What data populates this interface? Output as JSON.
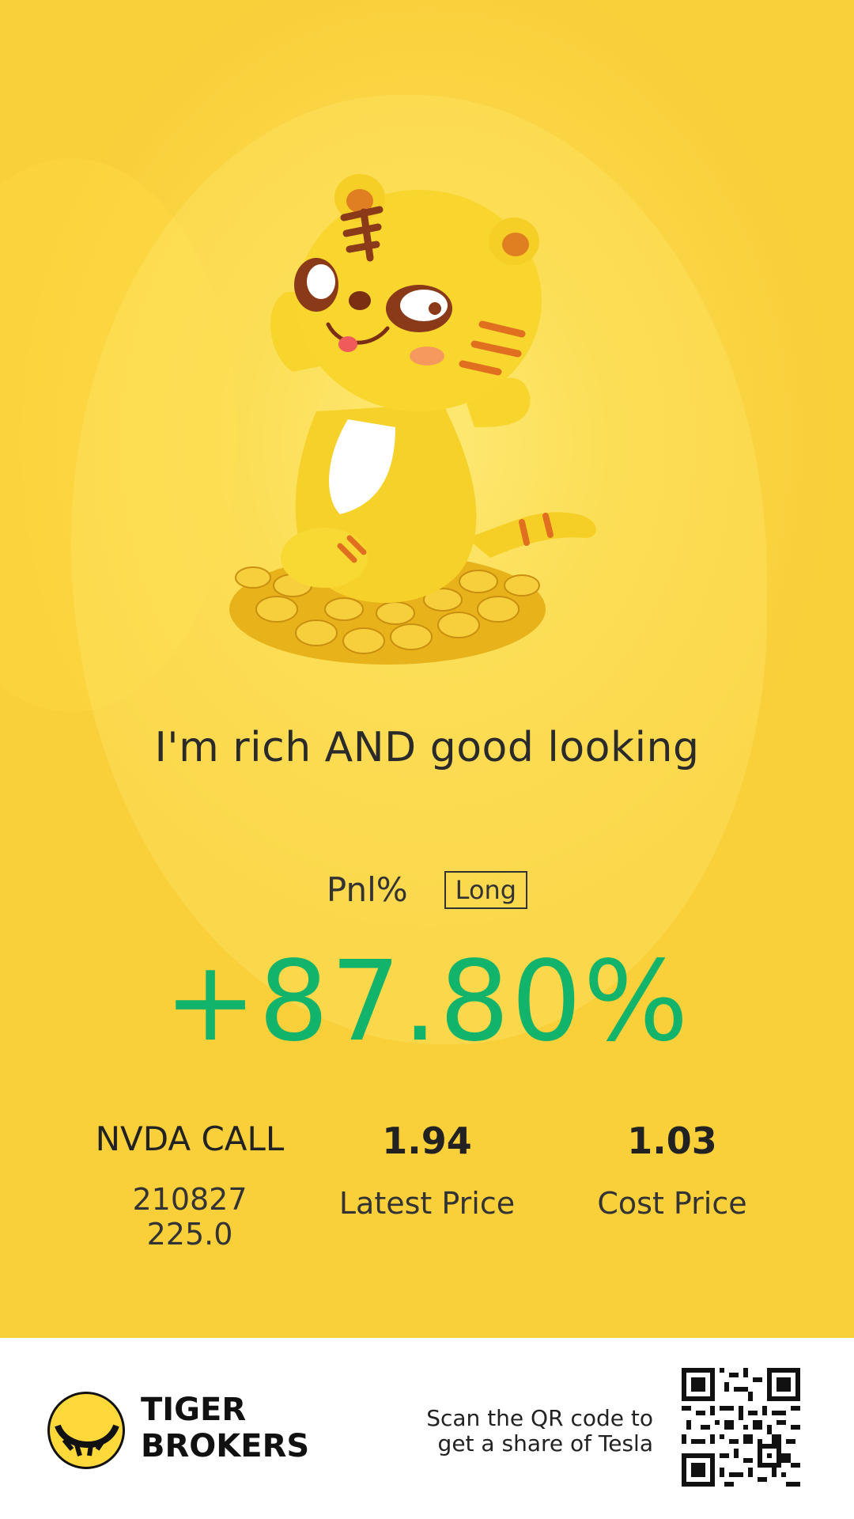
{
  "share_card": {
    "tagline": "I'm rich AND good looking",
    "pnl_label": "Pnl%",
    "position_badge": "Long",
    "pnl_value": "+87.80%",
    "pnl_color": "#12b36a",
    "instrument": {
      "name": "NVDA CALL",
      "detail": "210827 225.0"
    },
    "latest_price": {
      "value": "1.94",
      "label": "Latest Price"
    },
    "cost_price": {
      "value": "1.03",
      "label": "Cost Price"
    }
  },
  "footer": {
    "brand_line1": "TIGER",
    "brand_line2": "BROKERS",
    "scan_line1": "Scan the QR code to",
    "scan_line2": "get a share of Tesla",
    "logo_icon": "tiger-logo-icon",
    "qr_icon": "qr-code"
  }
}
